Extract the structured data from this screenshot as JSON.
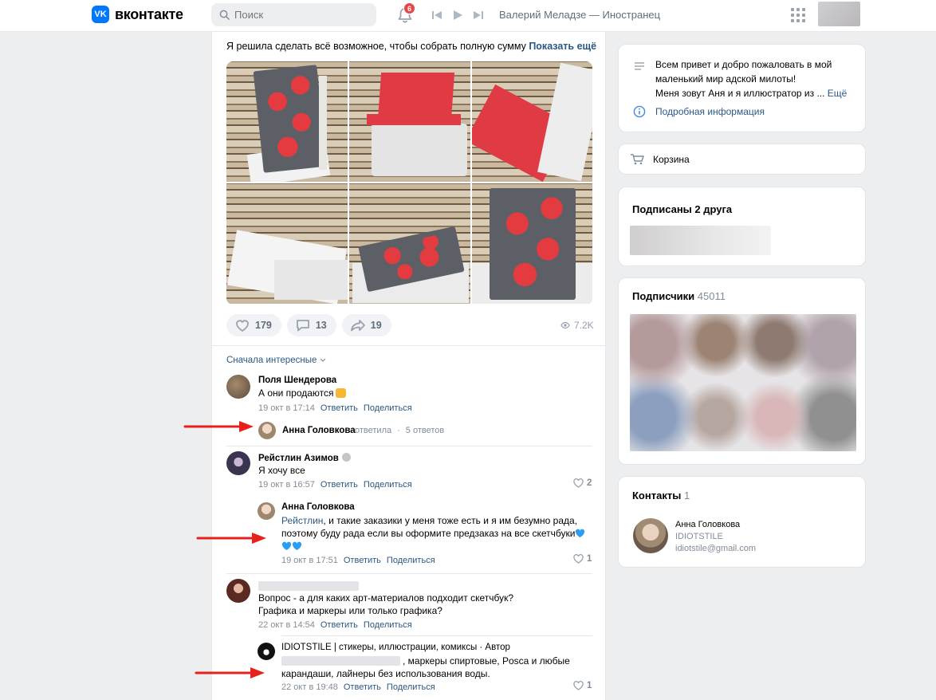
{
  "header": {
    "logo_text": "вконтакте",
    "logo_mark": "VK",
    "search_placeholder": "Поиск",
    "notifications_count": "6",
    "track_title": "Валерий Меладзе — Иностранец",
    "icons": [
      "search-icon",
      "bell-icon",
      "previous-track-icon",
      "play-icon",
      "next-track-icon",
      "apps-grid-icon"
    ]
  },
  "post": {
    "text": "Я решила сделать всё возможное, чтобы собрать полную сумму",
    "show_more": "Показать ещё",
    "likes": "179",
    "comments": "13",
    "shares": "19",
    "views": "7.2K"
  },
  "comments_section": {
    "sort_label": "Сначала интересные",
    "comments": [
      {
        "author": "Поля Шендерова",
        "text": "А они продаются",
        "date": "19 окт в 17:14",
        "reply": "Ответить",
        "share": "Поделиться",
        "thread": {
          "author": "Анна Головкова",
          "action": "ответила",
          "replies": "5 ответов"
        }
      },
      {
        "author": "Рейстлин Азимов",
        "text": "Я хочу все",
        "date": "19 окт в 16:57",
        "reply": "Ответить",
        "share": "Поделиться",
        "likes": "2",
        "answer": {
          "author": "Анна Головкова",
          "mention": "Рейстлин",
          "text_line1": ", и такие заказики у меня тоже есть и я им безумно рада,",
          "text_line2": "поэтому буду рада если вы оформите предзаказ на все скетчбуки",
          "date": "19 окт в 17:51",
          "reply": "Ответить",
          "share": "Поделиться",
          "likes": "1"
        }
      },
      {
        "author": "",
        "text_line1": "Вопрос - а для каких арт-материалов подходит скетчбук?",
        "text_line2": "Графика и маркеры или только графика?",
        "date": "22 окт в 14:54",
        "reply": "Ответить",
        "share": "Поделиться",
        "answer": {
          "author": "IDIOTSTILE | стикеры, иллюстрации, комиксы · Автор",
          "text_line1": ", маркеры спиртовые, Posca и любые",
          "text_line2": "карандаши, лайнеры без использования воды.",
          "date": "22 окт в 19:48",
          "reply": "Ответить",
          "share": "Поделиться",
          "likes": "1"
        }
      }
    ]
  },
  "sidebar": {
    "about": {
      "line1": "Всем привет и добро пожаловать в мой",
      "line2": "маленький мир адской милоты!",
      "line3": "Меня зовут Аня и я иллюстратор из ...",
      "more": "Ещё",
      "details": "Подробная информация"
    },
    "cart_label": "Корзина",
    "friends_title": "Подписаны 2 друга",
    "subscribers_title": "Подписчики",
    "subscribers_count": "45011",
    "contacts_title": "Контакты",
    "contacts_count": "1",
    "contact": {
      "name": "Анна Головкова",
      "role": "IDIOTSTILE",
      "email": "idiotstile@gmail.com"
    }
  },
  "colors": {
    "accent": "#2a5885",
    "brand": "#0077ff",
    "badge": "#e64646",
    "annotation_arrow": "#e8201c"
  }
}
